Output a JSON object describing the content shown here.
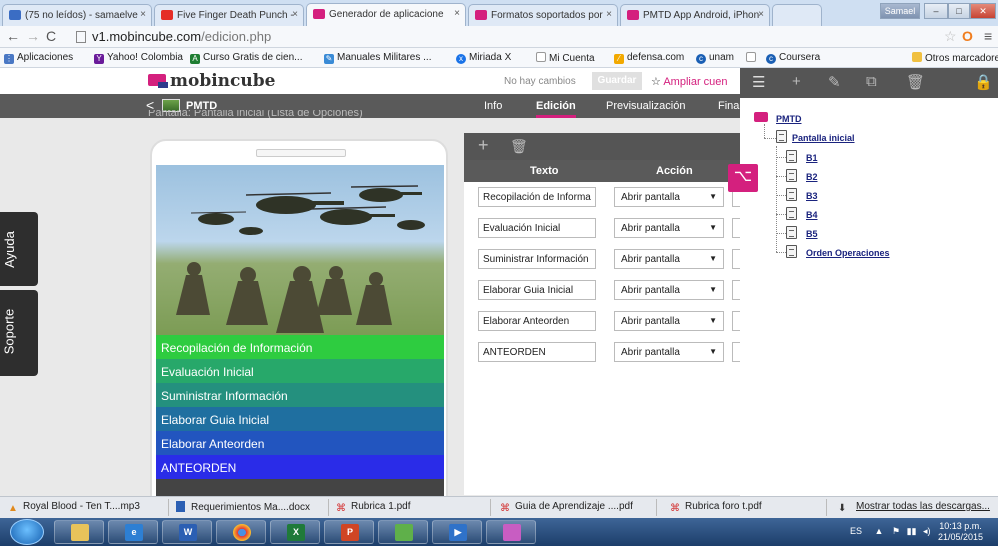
{
  "browser": {
    "tabs": [
      {
        "label": "(75 no leídos) - samaelve",
        "color": "#3b6dc4"
      },
      {
        "label": "Five Finger Death Punch -",
        "color": "#e52d27"
      },
      {
        "label": "Generador de aplicacione",
        "color": "#d4207e"
      },
      {
        "label": "Formatos soportados por",
        "color": "#d4207e"
      },
      {
        "label": "PMTD App Android, iPhon",
        "color": "#d4207e"
      }
    ],
    "user_button": "Samael",
    "url_host": "v1.mobincube.com",
    "url_path": "/edicion.php",
    "bookmarks": [
      {
        "label": "Aplicaciones",
        "icon": "apps-grid-icon"
      },
      {
        "label": "Yahoo! Colombia",
        "icon": "yahoo-icon"
      },
      {
        "label": "Curso Gratis de cien...",
        "icon": "course-icon"
      },
      {
        "label": "Manuales Militares ...",
        "icon": "manual-icon"
      },
      {
        "label": "Miriada X",
        "icon": "miriada-icon"
      },
      {
        "label": "Mi Cuenta",
        "icon": "page-icon"
      },
      {
        "label": "defensa.com",
        "icon": "defensa-icon"
      },
      {
        "label": "unam",
        "icon": "unam-icon"
      },
      {
        "label": "Coursera",
        "icon": "coursera-icon"
      }
    ],
    "other_bookmarks": "Otros marcadores"
  },
  "app": {
    "logo": "mobincube",
    "no_changes": "No hay cambios",
    "save": "Guardar",
    "expand": "Ampliar cuen",
    "back": "<",
    "title": "PMTD",
    "nav_tabs": [
      "Info",
      "Edición",
      "Previsualización",
      "Fina"
    ],
    "active_tab": "Edición",
    "breadcrumb": "Pantalla: Pantalla inicial (Lista de Opciones)",
    "side_tabs": [
      "Ayuda",
      "Soporte"
    ]
  },
  "phone_menu": [
    {
      "label": "Recopilación de Información",
      "color": "#2ecc40"
    },
    {
      "label": "Evaluación Inicial",
      "color": "#27a86a"
    },
    {
      "label": "Suministrar Información",
      "color": "#24907e"
    },
    {
      "label": "Elaborar Guia Inicial",
      "color": "#1f6fa0"
    },
    {
      "label": "Elaborar Anteorden",
      "color": "#2255bf"
    },
    {
      "label": "ANTEORDEN",
      "color": "#2a2ce8"
    }
  ],
  "options_table": {
    "headers": [
      "Texto",
      "Acción"
    ],
    "rows": [
      {
        "text": "Recopilación de Informa",
        "action": "Abrir pantalla"
      },
      {
        "text": "Evaluación Inicial",
        "action": "Abrir pantalla"
      },
      {
        "text": "Suministrar Información",
        "action": "Abrir pantalla"
      },
      {
        "text": "Elaborar Guia Inicial",
        "action": "Abrir pantalla"
      },
      {
        "text": "Elaborar Anteorden",
        "action": "Abrir pantalla"
      },
      {
        "text": "ANTEORDEN",
        "action": "Abrir pantalla"
      }
    ]
  },
  "tree": {
    "root": "PMTD",
    "screen": "Pantalla inicial",
    "children": [
      "B1",
      "B2",
      "B3",
      "B4",
      "B5",
      "Orden Operaciones"
    ]
  },
  "downloads": {
    "items": [
      {
        "label": "Royal Blood - Ten T....mp3"
      },
      {
        "label": "Requerimientos Ma....docx"
      },
      {
        "label": "Rubrica 1.pdf"
      },
      {
        "label": "Guia de Aprendizaje ....pdf"
      },
      {
        "label": "Rubrica foro t.pdf"
      }
    ],
    "show_all": "Mostrar todas las descargas..."
  },
  "taskbar": {
    "lang": "ES",
    "time": "10:13 p.m.",
    "date": "21/05/2015"
  },
  "colors": {
    "accent": "#d4207e",
    "dark_bar": "#555555"
  }
}
